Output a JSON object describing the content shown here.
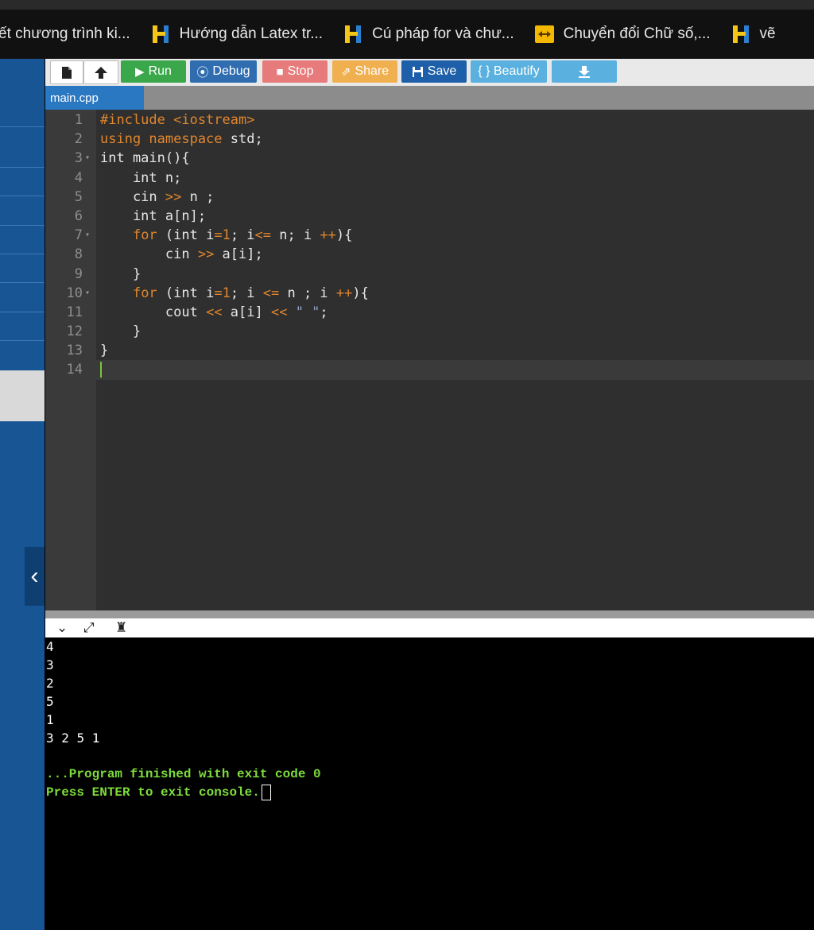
{
  "bookmarks": [
    {
      "label": "ết chương trình ki...",
      "icon": "none"
    },
    {
      "label": "Hướng dẫn Latex tr...",
      "icon": "h-logo-icon"
    },
    {
      "label": "Cú pháp for và chư...",
      "icon": "h-logo-icon"
    },
    {
      "label": "Chuyển đổi Chữ số,...",
      "icon": "convert-icon"
    },
    {
      "label": "vẽ",
      "icon": "h-logo-icon"
    }
  ],
  "toolbar": {
    "new_icon": "file-icon",
    "upload_icon": "upload-icon",
    "run": "Run",
    "debug": "Debug",
    "stop": "Stop",
    "share": "Share",
    "save": "Save",
    "beautify": "{ } Beautify",
    "download_icon": "download-icon"
  },
  "colors": {
    "run": "#3aa74a",
    "debug": "#2f6db0",
    "stop": "#e77b7b",
    "share": "#f0b050",
    "save": "#1d5fa8",
    "beautify": "#5ab1e0",
    "download": "#5ab1e0",
    "keyword": "#e0862d",
    "console_green": "#7ddc3c",
    "sidebar": "#175594"
  },
  "tab": {
    "filename": "main.cpp"
  },
  "code_lines": [
    "1",
    "2",
    "3",
    "4",
    "5",
    "6",
    "7",
    "8",
    "9",
    "10",
    "11",
    "12",
    "13",
    "14"
  ],
  "code": {
    "l1": "#include <iostream>",
    "l2_kw": "using namespace",
    "l2_rest": " std;",
    "l3": "int main(){",
    "l4": "    int n;",
    "l5a": "    cin ",
    "l5b": ">>",
    "l5c": " n ;",
    "l6": "    int a[n];",
    "l7_kw": "for",
    "l7_a": " (int i",
    "l7_eq": "=1",
    "l7_b": "; i",
    "l7_le": "<=",
    "l7_c": " n; i ",
    "l7_pp": "++",
    "l7_d": "){",
    "l8a": "        cin ",
    "l8b": ">>",
    "l8c": " a[i];",
    "l9": "    }",
    "l10_kw": "for",
    "l10_a": " (int i",
    "l10_eq": "=1",
    "l10_b": "; i ",
    "l10_le": "<=",
    "l10_c": " n ; i ",
    "l10_pp": "++",
    "l10_d": "){",
    "l11a": "        cout ",
    "l11b": "<<",
    "l11c": " a[i] ",
    "l11d": "<<",
    "l11e": " ",
    "l11str": "\" \"",
    "l11f": ";",
    "l12": "    }",
    "l13": "}"
  },
  "console": {
    "lines": [
      "4",
      "3",
      "2",
      "5",
      "1",
      "3 2 5 1",
      ""
    ],
    "finished": "...Program finished with exit code 0",
    "press": "Press ENTER to exit console."
  }
}
